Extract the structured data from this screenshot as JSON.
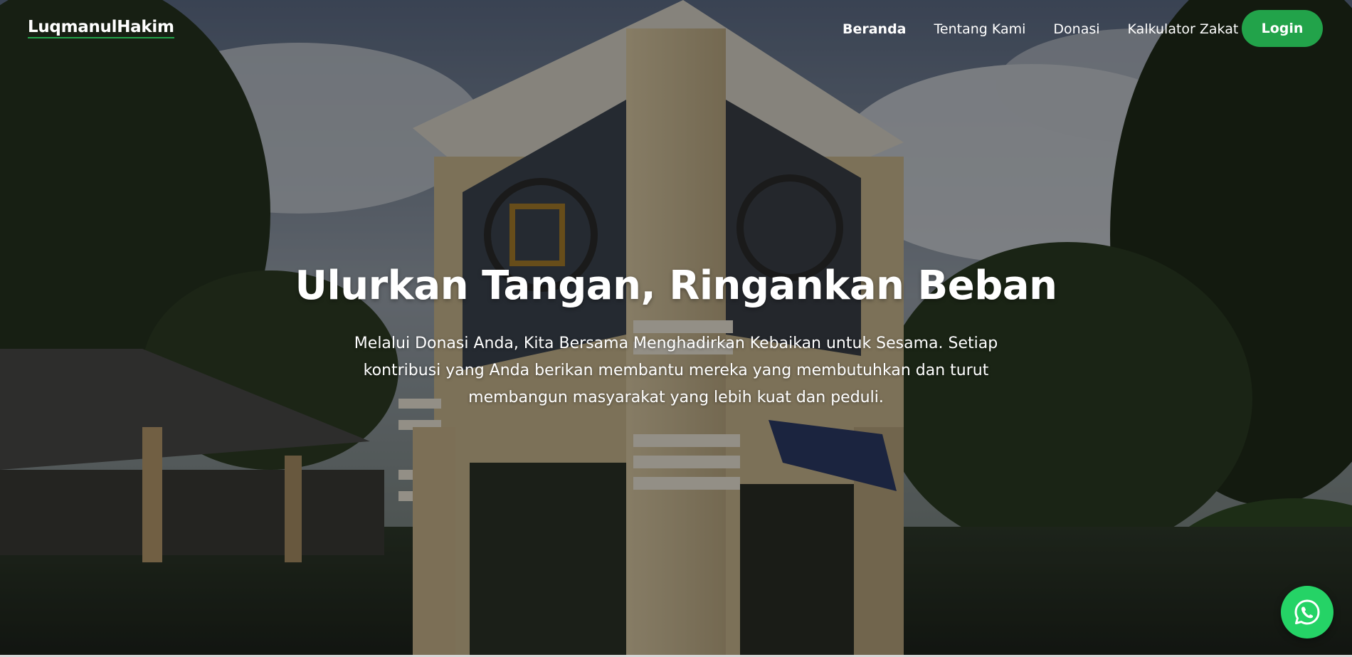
{
  "brand": {
    "name": "LuqmanulHakim"
  },
  "nav": {
    "items": [
      {
        "label": "Beranda",
        "active": true
      },
      {
        "label": "Tentang Kami",
        "active": false
      },
      {
        "label": "Donasi",
        "active": false
      },
      {
        "label": "Kalkulator Zakat",
        "active": false
      }
    ],
    "login_label": "Login"
  },
  "hero": {
    "title": "Ulurkan Tangan, Ringankan Beban",
    "description_lines": [
      "Melalui Donasi Anda, Kita Bersama Menghadirkan Kebaikan untuk Sesama. Setiap",
      "kontribusi yang Anda berikan membantu mereka yang membutuhkan dan turut",
      "membangun masyarakat yang lebih kuat dan peduli."
    ]
  },
  "floating": {
    "icon": "whatsapp-icon"
  },
  "colors": {
    "accent": "#22a34a",
    "whatsapp": "#25d366",
    "text": "#ffffff"
  }
}
